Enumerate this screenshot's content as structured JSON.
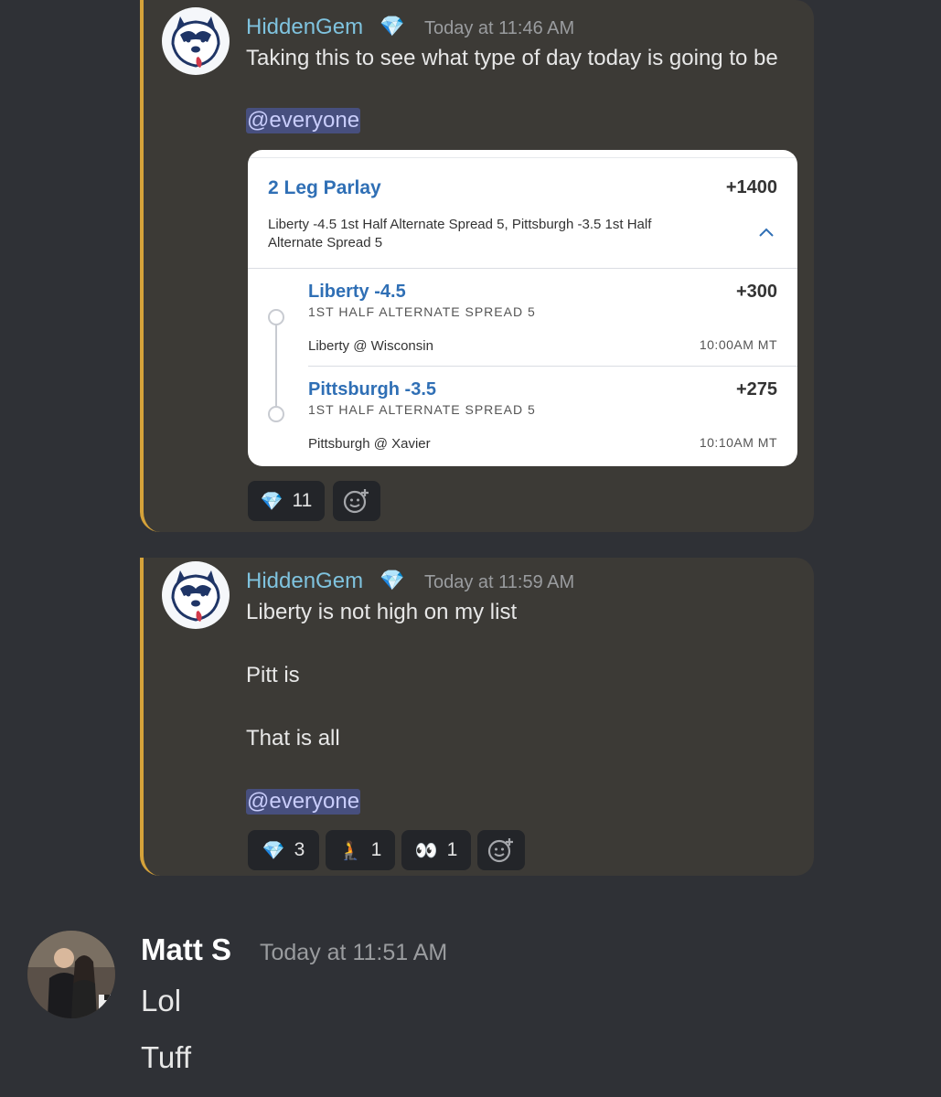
{
  "messages": [
    {
      "author": "HiddenGem",
      "author_badge": "💎",
      "timestamp": "Today at 11:46 AM",
      "lines": [
        "Taking this to see what type of day today is going to be"
      ],
      "mention": "@everyone",
      "bet_card": {
        "title": "2 Leg Parlay",
        "odds": "+1400",
        "description_line1": "Liberty -4.5 1st Half Alternate Spread 5, Pittsburgh -3.5 1st Half",
        "description_line2": "Alternate Spread 5",
        "collapse_icon": "chevron-up-icon",
        "legs": [
          {
            "pick": "Liberty -4.5",
            "odds": "+300",
            "market": "1ST HALF ALTERNATE SPREAD 5",
            "matchup": "Liberty @ Wisconsin",
            "time": "10:00AM MT"
          },
          {
            "pick": "Pittsburgh -3.5",
            "odds": "+275",
            "market": "1ST HALF ALTERNATE SPREAD 5",
            "matchup": "Pittsburgh @ Xavier",
            "time": "10:10AM MT"
          }
        ]
      },
      "reactions": [
        {
          "emoji": "💎",
          "count": "11"
        }
      ],
      "add_reaction_icon": "add-reaction-icon"
    },
    {
      "author": "HiddenGem",
      "author_badge": "💎",
      "timestamp": "Today at 11:59 AM",
      "lines": [
        "Liberty is not high on my list",
        "Pitt is",
        "That is all"
      ],
      "mention": "@everyone",
      "reactions": [
        {
          "emoji": "💎",
          "count": "3"
        },
        {
          "emoji": "🧎",
          "count": "1"
        },
        {
          "emoji": "👀",
          "count": "1"
        }
      ],
      "add_reaction_icon": "add-reaction-icon"
    }
  ],
  "reply": {
    "author": "Matt S",
    "timestamp": "Today at 11:51 AM",
    "lines": [
      "Lol",
      "Tuff"
    ]
  },
  "colors": {
    "background": "#2f3136",
    "quote_background": "#3c3a36",
    "quote_bar": "#d5a23a",
    "author_name": "#7fc3df",
    "mention_bg": "#474f7e",
    "bet_link": "#2f6fb5"
  }
}
